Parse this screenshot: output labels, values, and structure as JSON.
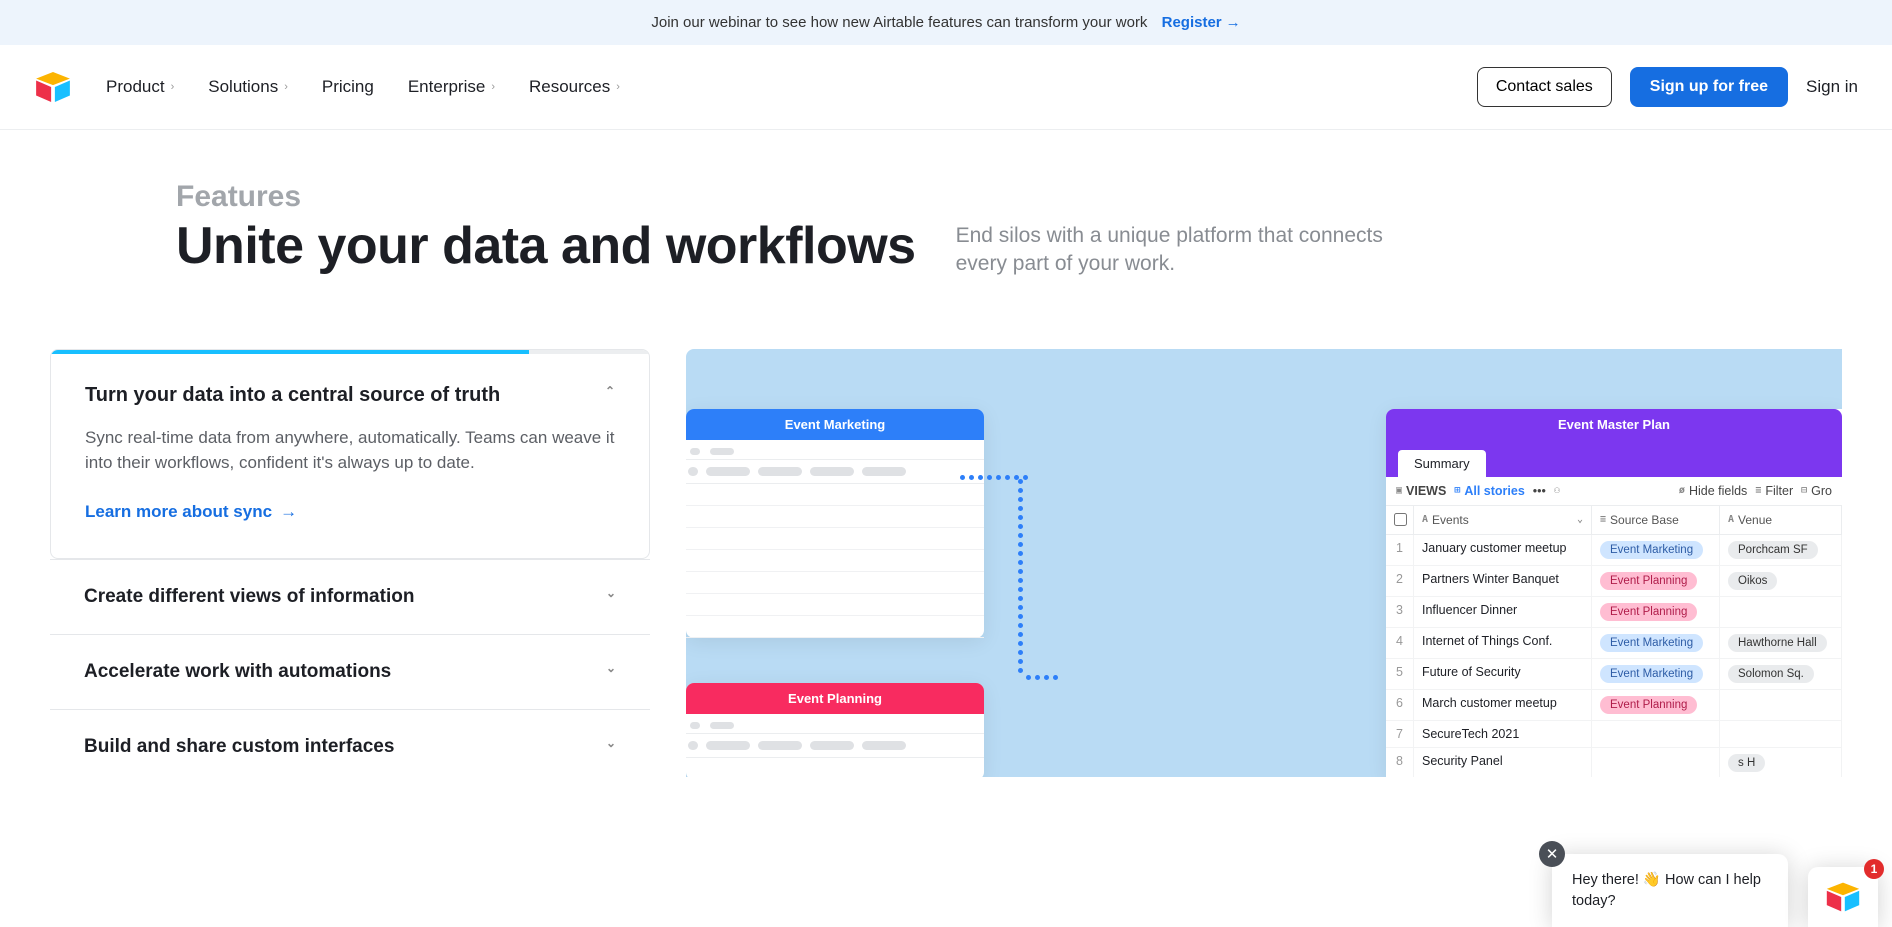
{
  "banner": {
    "text": "Join our webinar to see how new Airtable features can transform your work",
    "cta": "Register"
  },
  "nav": {
    "items": [
      "Product",
      "Solutions",
      "Pricing",
      "Enterprise",
      "Resources"
    ],
    "has_dropdown": [
      true,
      true,
      false,
      true,
      true
    ],
    "contact": "Contact sales",
    "signup": "Sign up for free",
    "signin": "Sign in"
  },
  "hero": {
    "eyebrow": "Features",
    "title": "Unite your data and workflows",
    "subtitle": "End silos with a unique platform that connects every part of your work."
  },
  "accordion": {
    "open": {
      "title": "Turn your data into a central source of truth",
      "text": "Sync real-time data from anywhere, automatically. Teams can weave it into their workflows, confident it's always up to date.",
      "link": "Learn more about sync"
    },
    "items": [
      "Create different views of information",
      "Accelerate work with automations",
      "Build and share custom interfaces"
    ]
  },
  "visual": {
    "pane1_title": "Event Marketing",
    "pane2_title": "Event Planning",
    "pane3_title": "Event Master Plan",
    "tab": "Summary",
    "views_label": "VIEWS",
    "all_stories": "All stories",
    "toolbar": {
      "hide": "Hide fields",
      "filter": "Filter",
      "group": "Gro"
    },
    "headers": {
      "events": "Events",
      "source": "Source Base",
      "venue": "Venue"
    },
    "rows": [
      {
        "n": "1",
        "event": "January customer meetup",
        "source": "Event Marketing",
        "source_type": "blue",
        "venue": "Porchcam SF"
      },
      {
        "n": "2",
        "event": "Partners Winter Banquet",
        "source": "Event Planning",
        "source_type": "pink",
        "venue": "Oikos"
      },
      {
        "n": "3",
        "event": "Influencer Dinner",
        "source": "Event Planning",
        "source_type": "pink",
        "venue": ""
      },
      {
        "n": "4",
        "event": "Internet of Things Conf.",
        "source": "Event Marketing",
        "source_type": "blue",
        "venue": "Hawthorne Hall"
      },
      {
        "n": "5",
        "event": "Future of Security",
        "source": "Event Marketing",
        "source_type": "blue",
        "venue": "Solomon Sq."
      },
      {
        "n": "6",
        "event": "March customer meetup",
        "source": "Event Planning",
        "source_type": "pink",
        "venue": ""
      },
      {
        "n": "7",
        "event": "SecureTech 2021",
        "source": "",
        "source_type": "",
        "venue": ""
      },
      {
        "n": "8",
        "event": "Security Panel",
        "source": "",
        "source_type": "",
        "venue": "s H"
      }
    ]
  },
  "chat": {
    "text_pre": "Hey there! ",
    "text_post": " How can I help today?",
    "badge": "1"
  }
}
